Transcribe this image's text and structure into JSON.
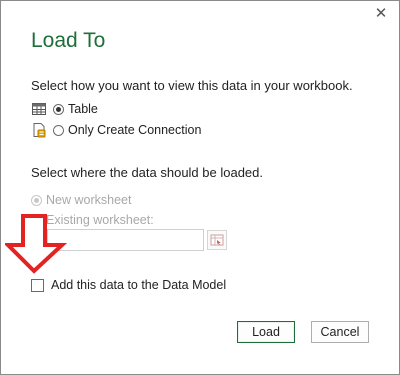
{
  "dialog": {
    "title": "Load To",
    "close_glyph": "✕",
    "view_prompt": "Select how you want to view this data in your workbook.",
    "view_options": [
      {
        "label": "Table",
        "selected": true,
        "icon": "table-icon"
      },
      {
        "label": "Only Create Connection",
        "selected": false,
        "icon": "connection-icon"
      }
    ],
    "location_prompt": "Select where the data should be loaded.",
    "location_options": [
      {
        "label": "New worksheet",
        "selected": true,
        "disabled": true
      },
      {
        "label": "Existing worksheet:",
        "selected": false,
        "disabled": true
      }
    ],
    "range_value": "",
    "data_model_checkbox": {
      "label": "Add this data to the Data Model",
      "checked": false
    },
    "buttons": {
      "load": "Load",
      "cancel": "Cancel"
    }
  },
  "colors": {
    "title": "#1f6f3a",
    "annotation_arrow": "#e32222",
    "disabled_text": "#a8a8a8"
  }
}
